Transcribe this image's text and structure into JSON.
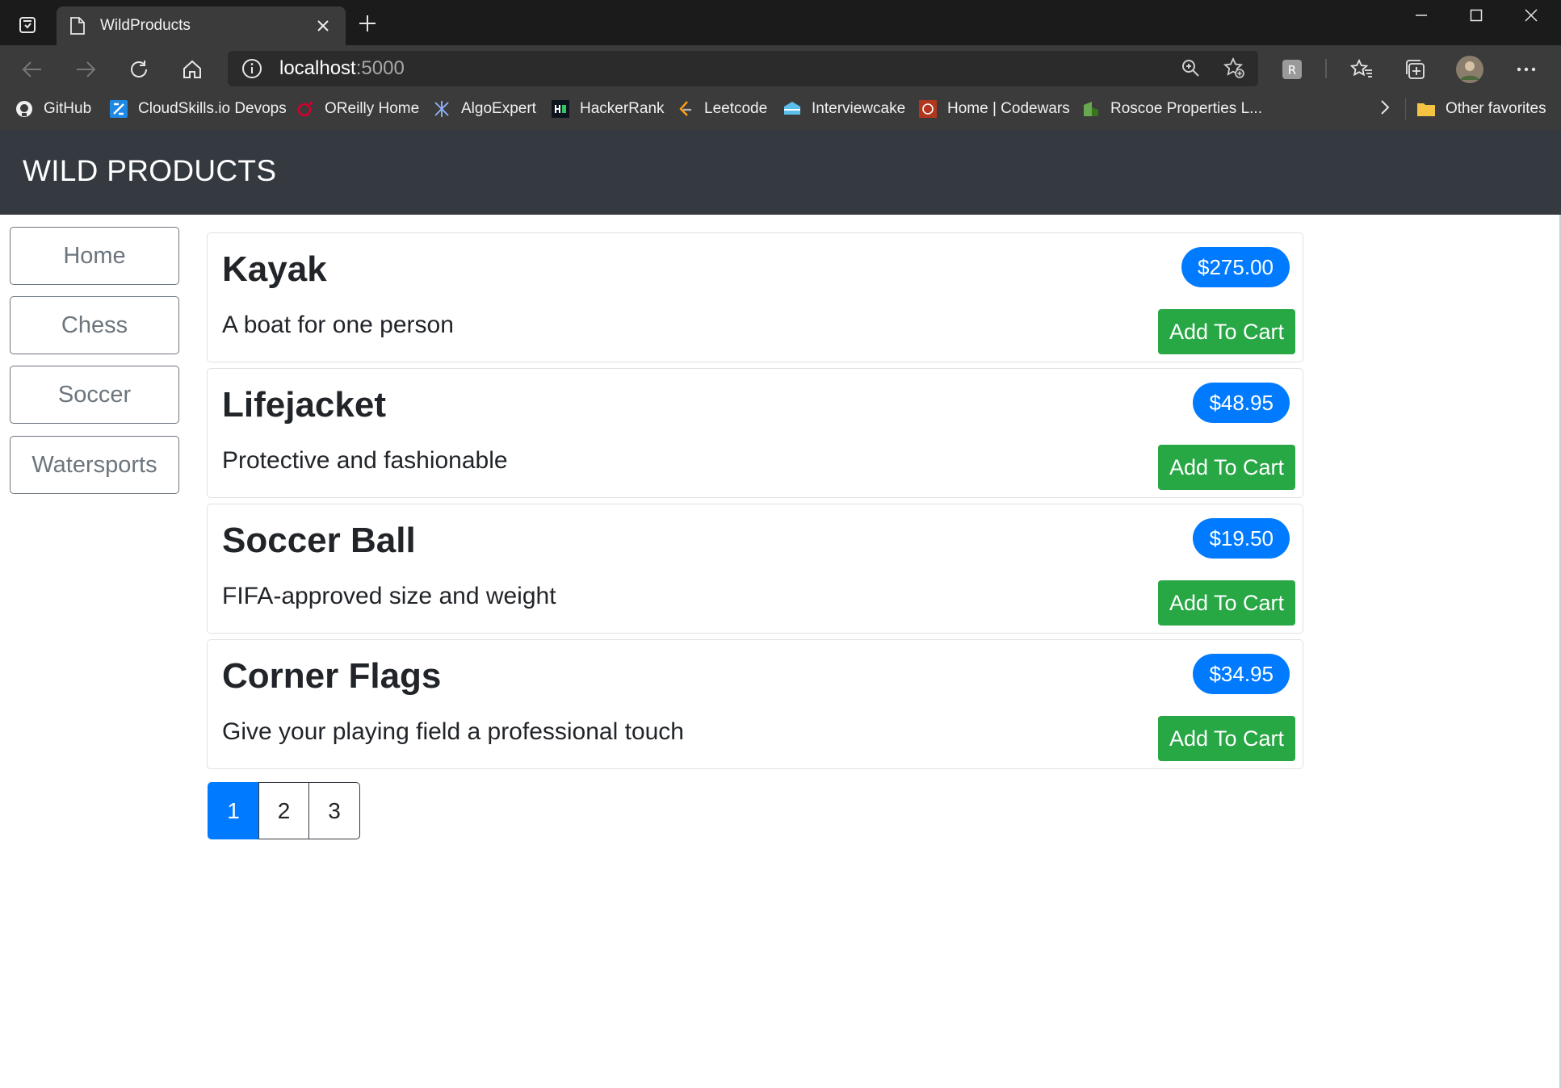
{
  "browser": {
    "tab_title": "WildProducts",
    "url_host": "localhost",
    "url_port": ":5000",
    "bookmarks": [
      {
        "label": "GitHub",
        "icon": "github-icon"
      },
      {
        "label": "CloudSkills.io Devops",
        "icon": "cloudskills-icon"
      },
      {
        "label": "OReilly Home",
        "icon": "oreilly-icon"
      },
      {
        "label": "AlgoExpert",
        "icon": "algoexpert-icon"
      },
      {
        "label": "HackerRank",
        "icon": "hackerrank-icon"
      },
      {
        "label": "Leetcode",
        "icon": "leetcode-icon"
      },
      {
        "label": "Interviewcake",
        "icon": "interviewcake-icon"
      },
      {
        "label": "Home | Codewars",
        "icon": "codewars-icon"
      },
      {
        "label": "Roscoe Properties L...",
        "icon": "roscoe-icon"
      }
    ],
    "other_favorites": "Other favorites"
  },
  "app": {
    "brand": "WILD PRODUCTS"
  },
  "categories": [
    "Home",
    "Chess",
    "Soccer",
    "Watersports"
  ],
  "products": [
    {
      "name": "Kayak",
      "description": "A boat for one person",
      "price": "$275.00",
      "cart_label": "Add To Cart"
    },
    {
      "name": "Lifejacket",
      "description": "Protective and fashionable",
      "price": "$48.95",
      "cart_label": "Add To Cart"
    },
    {
      "name": "Soccer Ball",
      "description": "FIFA-approved size and weight",
      "price": "$19.50",
      "cart_label": "Add To Cart"
    },
    {
      "name": "Corner Flags",
      "description": "Give your playing field a professional touch",
      "price": "$34.95",
      "cart_label": "Add To Cart"
    }
  ],
  "pagination": {
    "pages": [
      "1",
      "2",
      "3"
    ],
    "current": "1"
  },
  "colors": {
    "navbar": "#343a40",
    "price_badge": "#007bff",
    "add_to_cart": "#28a745",
    "active_page": "#007bff"
  }
}
